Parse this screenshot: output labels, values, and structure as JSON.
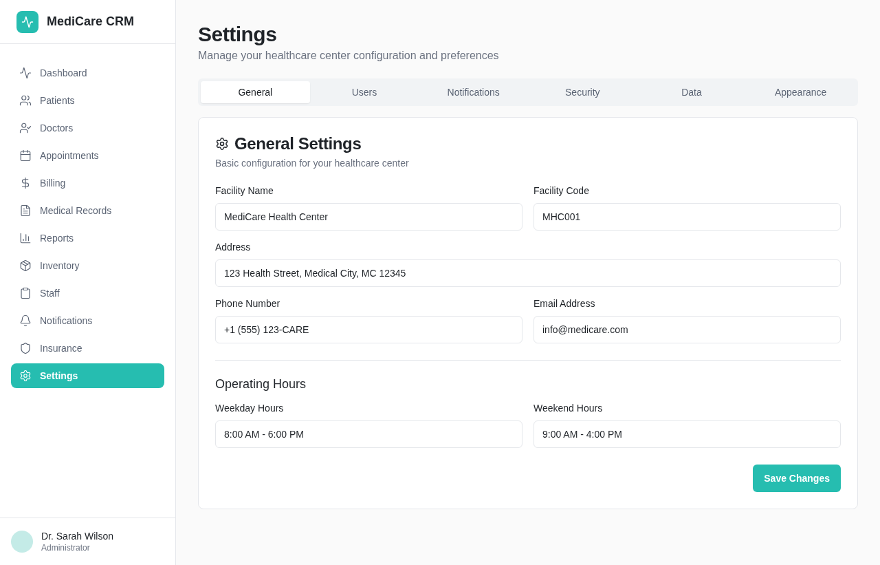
{
  "brand": {
    "name": "MediCare CRM"
  },
  "nav": [
    {
      "label": "Dashboard",
      "selected": false
    },
    {
      "label": "Patients",
      "selected": false
    },
    {
      "label": "Doctors",
      "selected": false
    },
    {
      "label": "Appointments",
      "selected": false
    },
    {
      "label": "Billing",
      "selected": false
    },
    {
      "label": "Medical Records",
      "selected": false
    },
    {
      "label": "Reports",
      "selected": false
    },
    {
      "label": "Inventory",
      "selected": false
    },
    {
      "label": "Staff",
      "selected": false
    },
    {
      "label": "Notifications",
      "selected": false
    },
    {
      "label": "Insurance",
      "selected": false
    },
    {
      "label": "Settings",
      "selected": true
    }
  ],
  "user": {
    "name": "Dr. Sarah Wilson",
    "role": "Administrator"
  },
  "page": {
    "title": "Settings",
    "subtitle": "Manage your healthcare center configuration and preferences"
  },
  "tabs": [
    {
      "label": "General",
      "selected": true
    },
    {
      "label": "Users",
      "selected": false
    },
    {
      "label": "Notifications",
      "selected": false
    },
    {
      "label": "Security",
      "selected": false
    },
    {
      "label": "Data",
      "selected": false
    },
    {
      "label": "Appearance",
      "selected": false
    }
  ],
  "card": {
    "title": "General Settings",
    "subtitle": "Basic configuration for your healthcare center",
    "rows": [
      [
        {
          "label": "Facility Name",
          "value": "MediCare Health Center"
        },
        {
          "label": "Facility Code",
          "value": "MHC001"
        }
      ],
      [
        {
          "label": "Address",
          "value": "123 Health Street, Medical City, MC 12345"
        }
      ],
      [
        {
          "label": "Phone Number",
          "value": "+1 (555) 123-CARE"
        },
        {
          "label": "Email Address",
          "value": "info@medicare.com"
        }
      ]
    ],
    "section_title": "Operating Hours",
    "section_rows": [
      [
        {
          "label": "Weekday Hours",
          "value": "8:00 AM - 6:00 PM"
        },
        {
          "label": "Weekend Hours",
          "value": "9:00 AM - 4:00 PM"
        }
      ]
    ],
    "save_button": "Save Changes"
  }
}
